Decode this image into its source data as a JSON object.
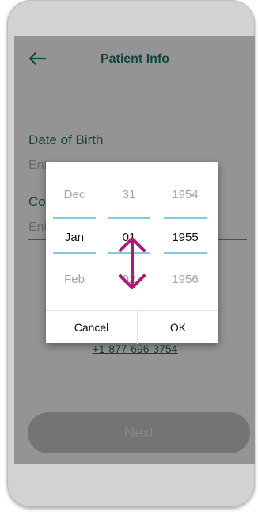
{
  "header": {
    "title": "Patient Info"
  },
  "form": {
    "dob_label": "Date of Birth",
    "dob_placeholder": "Ente",
    "contact_label": "Con",
    "contact_placeholder": "Ente",
    "help_phone": "+1-877-696-3754",
    "next_label": "Next"
  },
  "picker": {
    "month": {
      "prev": "Dec",
      "selected": "Jan",
      "next": "Feb"
    },
    "day": {
      "prev": "31",
      "selected": "01",
      "next": "02"
    },
    "year": {
      "prev": "1954",
      "selected": "1955",
      "next": "1956"
    },
    "cancel_label": "Cancel",
    "ok_label": "OK"
  },
  "colors": {
    "accent": "#1d7a6c",
    "picker_line": "#7fcde0",
    "gesture_arrow": "#b0177a"
  },
  "icons": {
    "back": "arrow-left-icon",
    "gesture": "vertical-swipe-arrow-icon"
  }
}
